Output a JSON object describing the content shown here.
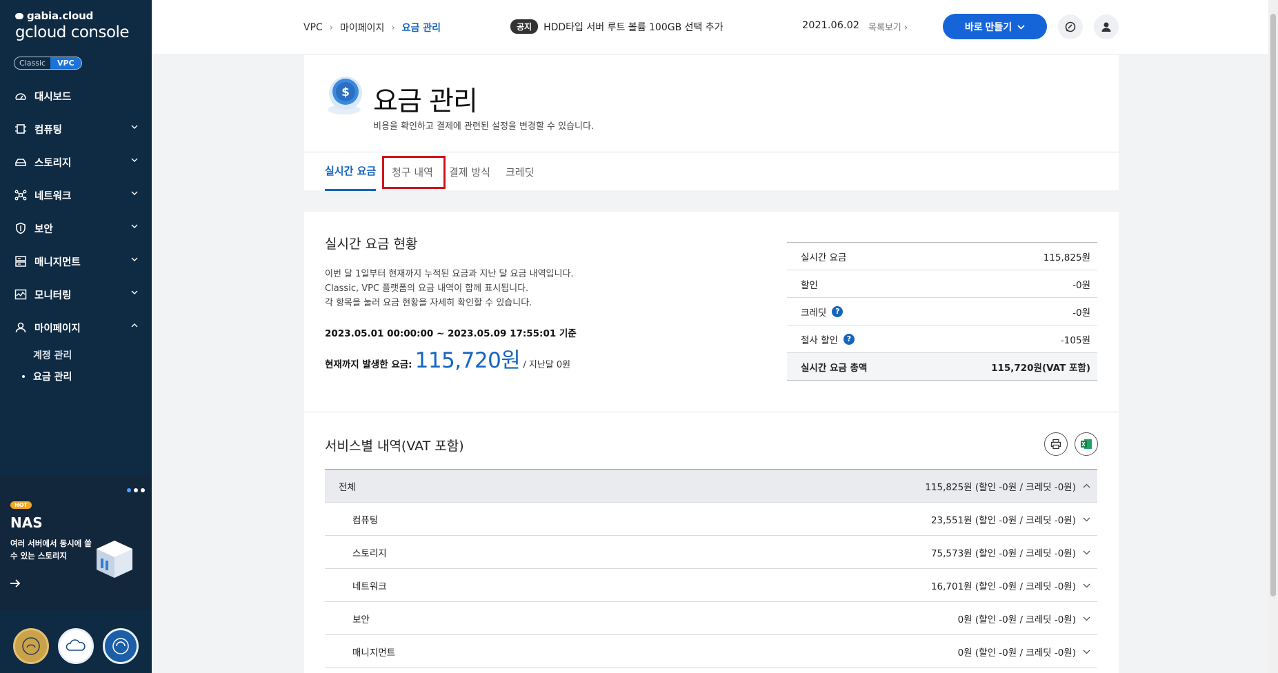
{
  "sidebar": {
    "brand_small": "gabia.cloud",
    "brand_big": "gcloud console",
    "toggle": {
      "classic": "Classic",
      "vpc": "VPC"
    },
    "items": [
      {
        "label": "대시보드",
        "icon": "dashboard-icon"
      },
      {
        "label": "컴퓨팅",
        "icon": "chip-icon"
      },
      {
        "label": "스토리지",
        "icon": "storage-icon"
      },
      {
        "label": "네트워크",
        "icon": "network-icon"
      },
      {
        "label": "보안",
        "icon": "shield-icon"
      },
      {
        "label": "매니지먼트",
        "icon": "management-icon"
      },
      {
        "label": "모니터링",
        "icon": "monitoring-icon"
      },
      {
        "label": "마이페이지",
        "icon": "user-icon"
      }
    ],
    "subitems": [
      {
        "label": "계정 관리"
      },
      {
        "label": "요금 관리"
      }
    ],
    "banner": {
      "hot": "HOT",
      "title": "NAS",
      "desc": "여러 서버에서 동시에 쓸 수 있는 스토리지"
    }
  },
  "topbar": {
    "breadcrumb": [
      "VPC",
      "마이페이지",
      "요금 관리"
    ],
    "notice_tag": "공지",
    "notice_text": "HDD타입 서버 루트 볼륨 100GB 선택 추가",
    "notice_date": "2021.06.02",
    "notice_more": "목록보기",
    "make_button": "바로 만들기"
  },
  "page": {
    "title": "요금 관리",
    "subtitle": "비용을 확인하고 결제에 관련된 설정을 변경할 수 있습니다.",
    "tabs": [
      "실시간 요금",
      "청구 내역",
      "결제 방식",
      "크레딧"
    ]
  },
  "realtime": {
    "title": "실시간 요금 현황",
    "desc": [
      "이번 달 1일부터 현재까지 누적된 요금과 지난 달 요금 내역입니다.",
      "Classic, VPC 플랫폼의 요금 내역이 함께 표시됩니다.",
      "각 항목을 눌러 요금 현황을 자세히 확인할 수 있습니다."
    ],
    "period": "2023.05.01 00:00:00 ~ 2023.05.09 17:55:01 기준",
    "amount_label": "현재까지 발생한 요금:",
    "amount": "115,720원",
    "prev": "/ 지난달 0원",
    "rows": [
      {
        "label": "실시간 요금",
        "value": "115,825원"
      },
      {
        "label": "할인",
        "value": "-0원"
      },
      {
        "label": "크레딧",
        "value": "-0원"
      },
      {
        "label": "절사 할인",
        "value": "-105원"
      },
      {
        "label": "실시간 요금 총액",
        "value": "115,720원(VAT 포함)"
      }
    ]
  },
  "services": {
    "title": "서비스별 내역(VAT 포함)",
    "rows": [
      {
        "label": "전체",
        "value": "115,825원 (할인 -0원 / 크레딧 -0원)"
      },
      {
        "label": "컴퓨팅",
        "value": "23,551원 (할인 -0원 / 크레딧 -0원)"
      },
      {
        "label": "스토리지",
        "value": "75,573원 (할인 -0원 / 크레딧 -0원)"
      },
      {
        "label": "네트워크",
        "value": "16,701원 (할인 -0원 / 크레딧 -0원)"
      },
      {
        "label": "보안",
        "value": "0원 (할인 -0원 / 크레딧 -0원)"
      },
      {
        "label": "매니지먼트",
        "value": "0원 (할인 -0원 / 크레딧 -0원)"
      }
    ]
  },
  "colors": {
    "sidebar_bg": "#0f2a43",
    "accent": "#1565c0",
    "highlight": "#d0141b"
  }
}
